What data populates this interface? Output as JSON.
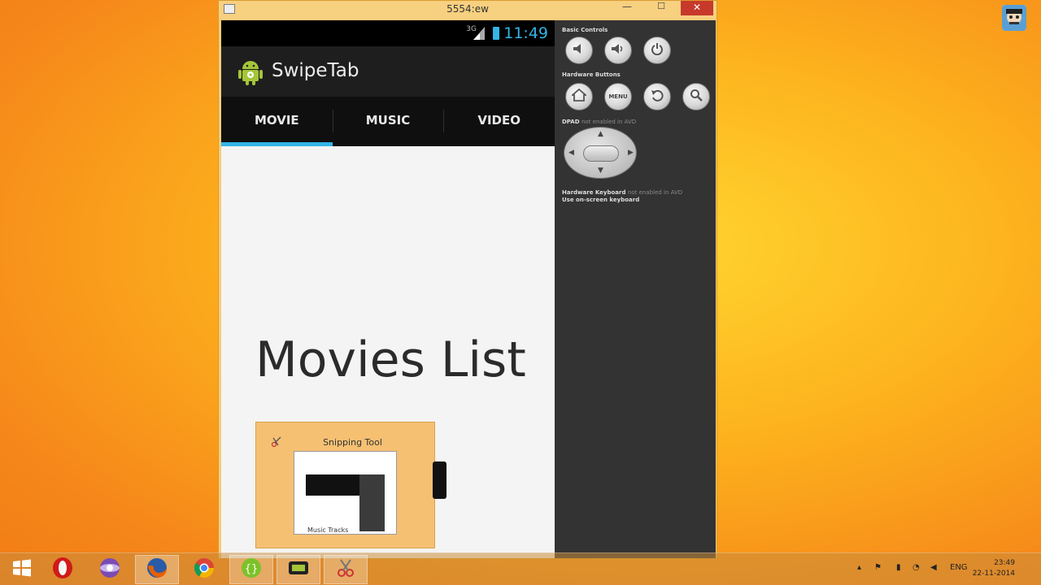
{
  "window": {
    "title": "5554:ew",
    "close_glyph": "✕",
    "minimize_glyph": "—",
    "maximize_glyph": "☐"
  },
  "statusbar": {
    "network": "3G",
    "time": "11:49"
  },
  "actionbar": {
    "title": "SwipeTab",
    "logo": "android-icon"
  },
  "tabs": [
    {
      "label": "MOVIE",
      "active": true
    },
    {
      "label": "MUSIC",
      "active": false
    },
    {
      "label": "VIDEO",
      "active": false
    }
  ],
  "content": {
    "heading": "Movies List"
  },
  "controls": {
    "basic_label": "Basic Controls",
    "hardware_label": "Hardware Buttons",
    "dpad_label": "DPAD",
    "dpad_note": "not enabled in AVD",
    "keyboard_label": "Hardware Keyboard",
    "keyboard_note": "not enabled in AVD",
    "keyboard_line2": "Use on-screen keyboard",
    "menu_label": "MENU"
  },
  "snipping": {
    "title": "Snipping Tool",
    "preview_label": "Music Tracks"
  },
  "taskbar": {
    "apps": [
      "start-icon",
      "opera-icon",
      "app-icon",
      "firefox-icon",
      "chrome-icon",
      "code-icon",
      "android-sdk-icon",
      "snipping-tool-icon"
    ],
    "language": "ENG",
    "time": "23:49",
    "date": "22-11-2014"
  },
  "colors": {
    "accent": "#33b5e5",
    "desktop": "#f7931e"
  }
}
